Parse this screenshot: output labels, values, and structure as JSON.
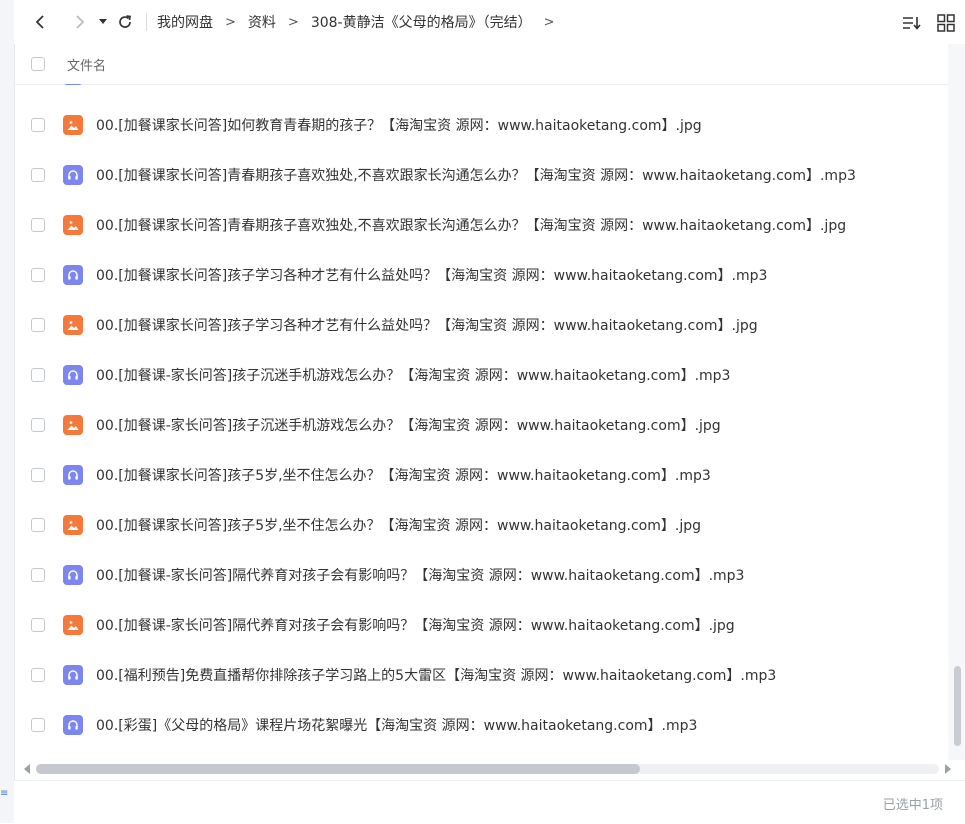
{
  "breadcrumb": {
    "items": [
      "我的网盘",
      "资料",
      "308-黄静洁《父母的格局》（完结）"
    ],
    "separator": ">"
  },
  "header": {
    "column_name": "文件名"
  },
  "files": [
    {
      "name": "00.[加餐课家长问答]如何教育青春期的孩子？【海淘宝资 源网：www.haitaoketang.com】.mp3",
      "type": "mp3"
    },
    {
      "name": "00.[加餐课家长问答]如何教育青春期的孩子？【海淘宝资 源网：www.haitaoketang.com】.jpg",
      "type": "jpg"
    },
    {
      "name": "00.[加餐课家长问答]青春期孩子喜欢独处,不喜欢跟家长沟通怎么办？【海淘宝资 源网：www.haitaoketang.com】.mp3",
      "type": "mp3"
    },
    {
      "name": "00.[加餐课家长问答]青春期孩子喜欢独处,不喜欢跟家长沟通怎么办？【海淘宝资 源网：www.haitaoketang.com】.jpg",
      "type": "jpg"
    },
    {
      "name": "00.[加餐课家长问答]孩子学习各种才艺有什么益处吗？【海淘宝资 源网：www.haitaoketang.com】.mp3",
      "type": "mp3"
    },
    {
      "name": "00.[加餐课家长问答]孩子学习各种才艺有什么益处吗？【海淘宝资 源网：www.haitaoketang.com】.jpg",
      "type": "jpg"
    },
    {
      "name": "00.[加餐课-家长问答]孩子沉迷手机游戏怎么办？【海淘宝资 源网：www.haitaoketang.com】.mp3",
      "type": "mp3"
    },
    {
      "name": "00.[加餐课-家长问答]孩子沉迷手机游戏怎么办？【海淘宝资 源网：www.haitaoketang.com】.jpg",
      "type": "jpg"
    },
    {
      "name": "00.[加餐课家长问答]孩子5岁,坐不住怎么办？【海淘宝资 源网：www.haitaoketang.com】.mp3",
      "type": "mp3"
    },
    {
      "name": "00.[加餐课家长问答]孩子5岁,坐不住怎么办？【海淘宝资 源网：www.haitaoketang.com】.jpg",
      "type": "jpg"
    },
    {
      "name": "00.[加餐课-家长问答]隔代养育对孩子会有影响吗？【海淘宝资 源网：www.haitaoketang.com】.mp3",
      "type": "mp3"
    },
    {
      "name": "00.[加餐课-家长问答]隔代养育对孩子会有影响吗？【海淘宝资 源网：www.haitaoketang.com】.jpg",
      "type": "jpg"
    },
    {
      "name": "00.[福利预告]免费直播帮你排除孩子学习路上的5大雷区【海淘宝资 源网：www.haitaoketang.com】.mp3",
      "type": "mp3"
    },
    {
      "name": "00.[彩蛋]《父母的格局》课程片场花絮曝光【海淘宝资 源网：www.haitaoketang.com】.mp3",
      "type": "mp3"
    }
  ],
  "status": {
    "selection_text": "已选中1项"
  },
  "colors": {
    "image_icon": "#f5793b",
    "audio_icon": "#7d86ee"
  },
  "icons": {
    "back": "chevron-left-icon",
    "forward": "chevron-right-icon",
    "dropdown": "caret-down-icon",
    "refresh": "refresh-icon",
    "sort": "sort-icon",
    "grid": "grid-view-icon",
    "jpg": "image-file-icon",
    "mp3": "audio-file-icon"
  }
}
